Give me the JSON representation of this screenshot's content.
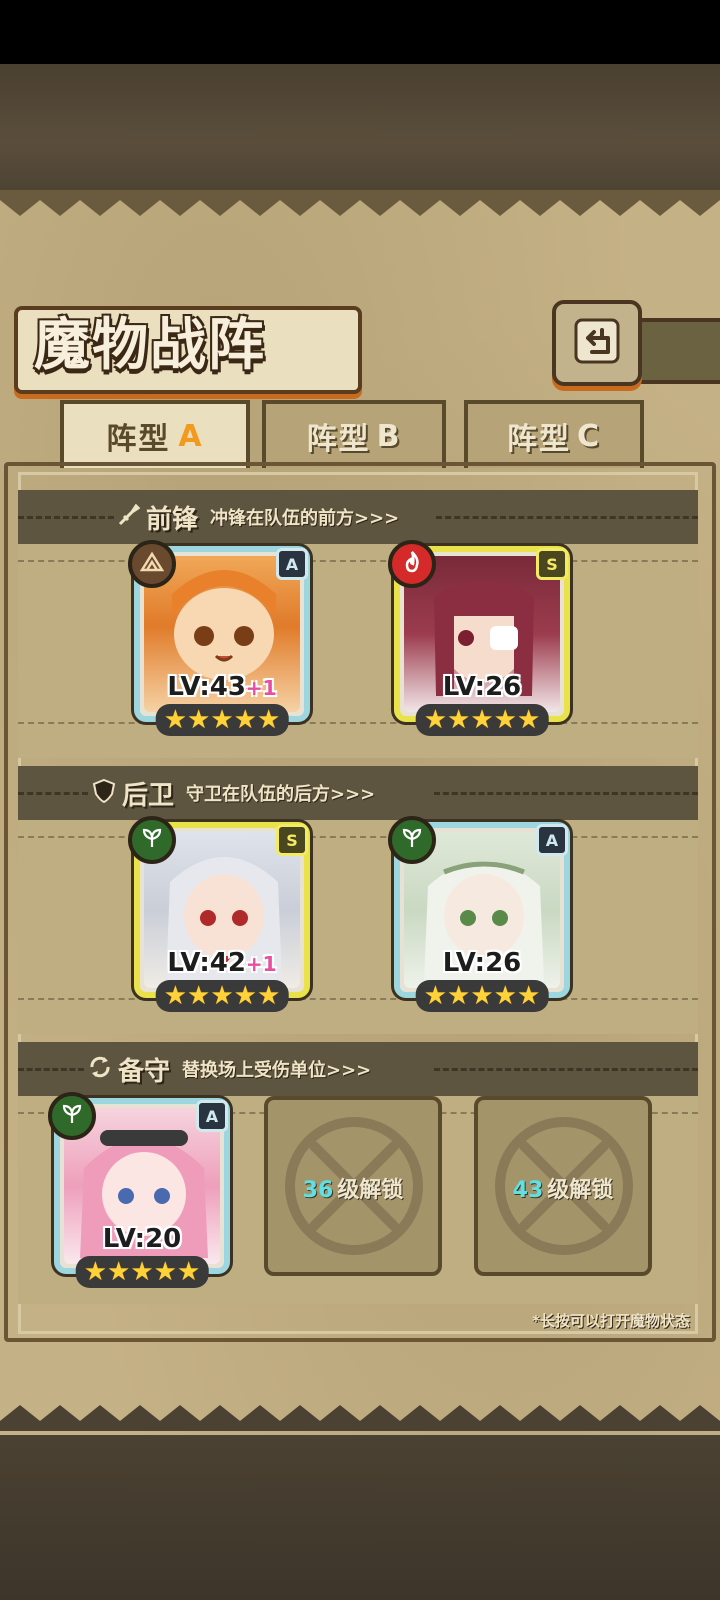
{
  "screen": {
    "title": "魔物战阵",
    "tabs": [
      {
        "label": "阵型",
        "letter": "A",
        "active": true
      },
      {
        "label": "阵型",
        "letter": "B",
        "active": false
      },
      {
        "label": "阵型",
        "letter": "C",
        "active": false
      }
    ],
    "sections": {
      "front": {
        "name": "前锋",
        "desc": "冲锋在队伍的前方>>>"
      },
      "rear": {
        "name": "后卫",
        "desc": "守卫在队伍的后方>>>"
      },
      "reserve": {
        "name": "备守",
        "desc": "替换场上受伤单位>>>"
      }
    },
    "hint": "*长按可以打开魔物状态",
    "colors": {
      "accent_orange": "#f29a1e",
      "rank_a": "#9ed6e0",
      "rank_s": "#e9e24a",
      "earth": "#6a4a2e",
      "fire": "#d42a2a",
      "wood": "#2f6a2a"
    }
  },
  "cards": {
    "front_1": {
      "lv": "LV:43",
      "bonus": "+1",
      "rank": "A",
      "element": "earth-icon",
      "stars": 5
    },
    "front_2": {
      "lv": "LV:26",
      "bonus": "",
      "rank": "S",
      "element": "fire-icon",
      "stars": 5
    },
    "rear_1": {
      "lv": "LV:42",
      "bonus": "+1",
      "rank": "S",
      "element": "leaf-icon",
      "stars": 5
    },
    "rear_2": {
      "lv": "LV:26",
      "bonus": "",
      "rank": "A",
      "element": "leaf-icon",
      "stars": 5
    },
    "reserve_1": {
      "lv": "LV:20",
      "bonus": "",
      "rank": "A",
      "element": "leaf-icon",
      "stars": 5
    }
  },
  "locked_slots": [
    {
      "level": "36",
      "text": "级解锁"
    },
    {
      "level": "43",
      "text": "级解锁"
    }
  ]
}
